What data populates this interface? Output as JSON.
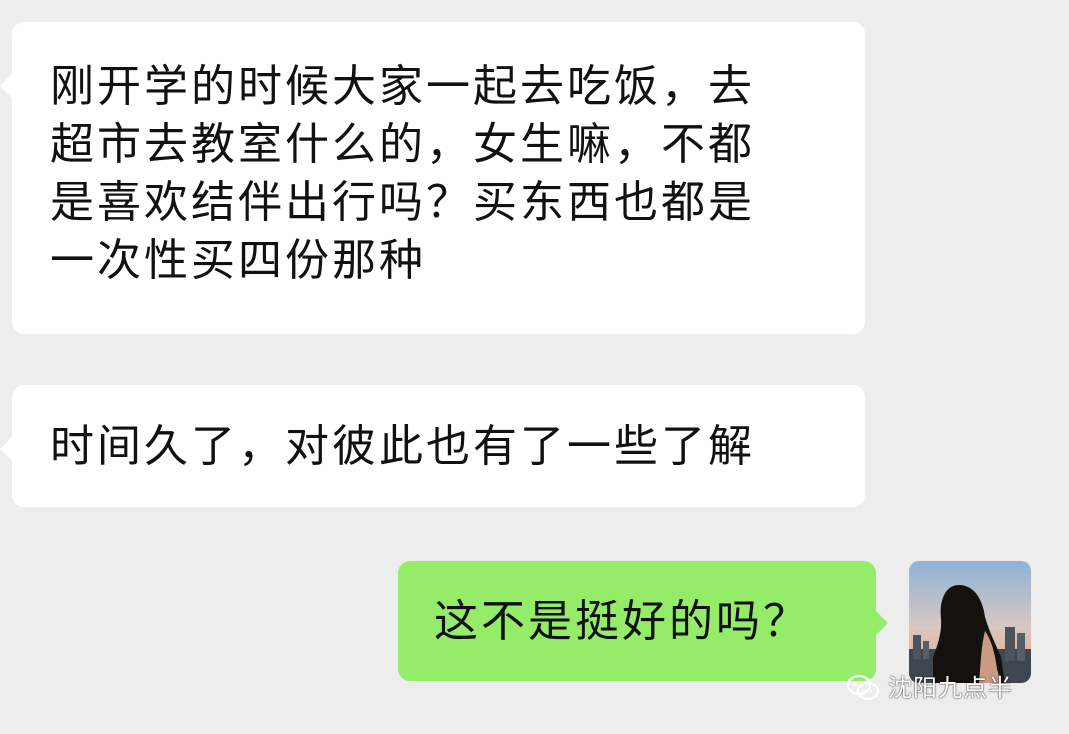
{
  "chat": {
    "messages": [
      {
        "direction": "incoming",
        "lines": [
          "刚开学的时候大家一起去吃饭，去",
          "超市去教室什么的，女生嘛，不都",
          "是喜欢结伴出行吗？买东西也都是",
          "一次性买四份那种"
        ]
      },
      {
        "direction": "incoming",
        "lines": [
          "时间久了，对彼此也有了一些了解"
        ]
      },
      {
        "direction": "outgoing",
        "lines": [
          "这不是挺好的吗？"
        ]
      }
    ]
  },
  "watermark": {
    "text": "沈阳九点半",
    "icon": "wechat-icon"
  },
  "avatar": {
    "icon": "avatar"
  },
  "colors": {
    "background": "#ededed",
    "incoming_bubble": "#ffffff",
    "outgoing_bubble": "#95ec69",
    "text": "#111111"
  }
}
